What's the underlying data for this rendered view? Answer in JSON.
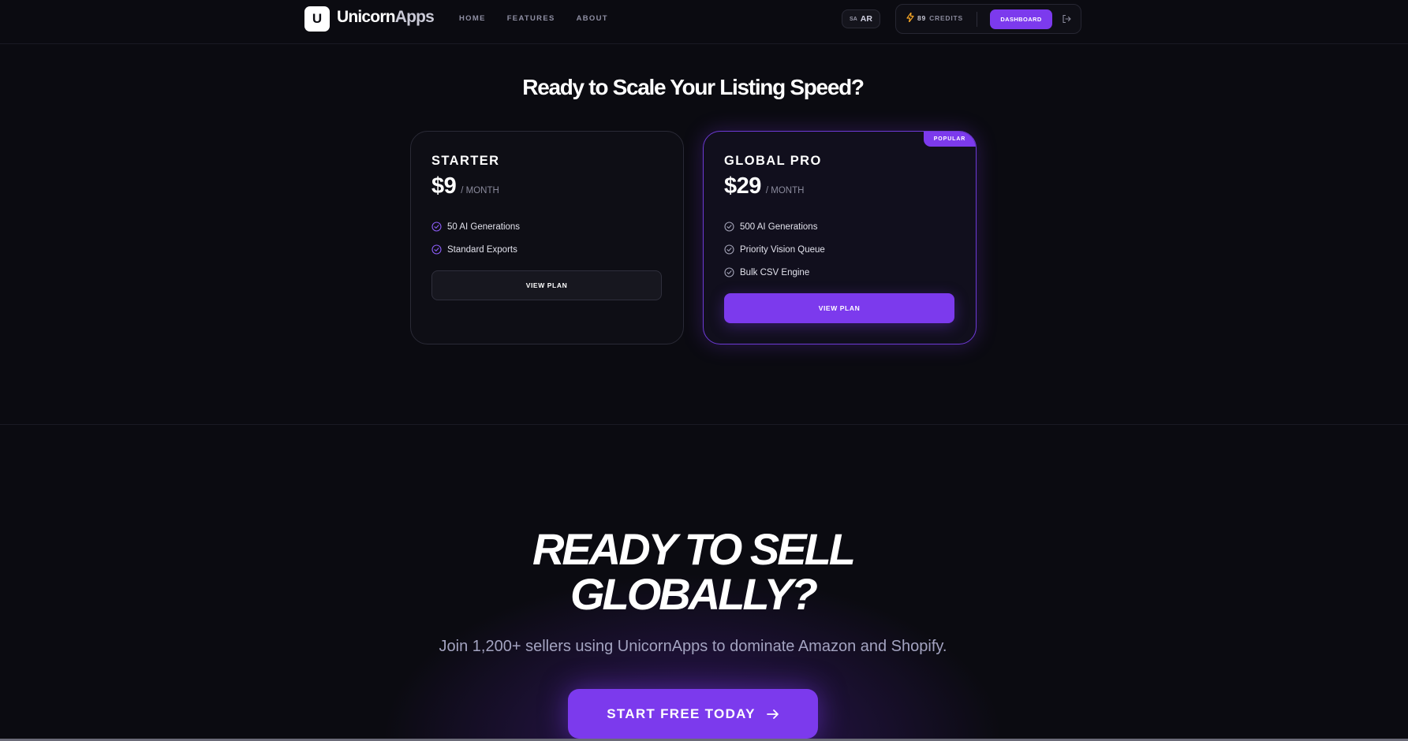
{
  "header": {
    "logo_letter": "U",
    "brand_main": "Unicorn",
    "brand_suffix": "Apps",
    "nav": [
      "HOME",
      "FEATURES",
      "ABOUT"
    ],
    "lang_country": "SA",
    "lang_code": "AR",
    "credits_count": "89",
    "credits_label": "CREDITS",
    "dashboard_label": "DASHBOARD",
    "logout_icon": "logout-icon"
  },
  "pricing": {
    "title": "Ready to Scale Your Listing Speed?",
    "plans": [
      {
        "name": "STARTER",
        "price": "$9",
        "period": "/ MONTH",
        "features": [
          "50 AI Generations",
          "Standard Exports"
        ],
        "button": "VIEW PLAN",
        "popular": false
      },
      {
        "name": "GLOBAL PRO",
        "price": "$29",
        "period": "/ MONTH",
        "features": [
          "500 AI Generations",
          "Priority Vision Queue",
          "Bulk CSV Engine"
        ],
        "button": "VIEW PLAN",
        "badge": "POPULAR",
        "popular": true
      }
    ]
  },
  "cta": {
    "title_line1": "READY TO SELL",
    "title_line2": "GLOBALLY?",
    "subtitle": "Join 1,200+ sellers using UnicornApps to dominate Amazon and Shopify.",
    "button": "START FREE TODAY"
  },
  "colors": {
    "background": "#0b0b11",
    "accent": "#7c3aed",
    "credit_bolt": "#f5a524"
  }
}
